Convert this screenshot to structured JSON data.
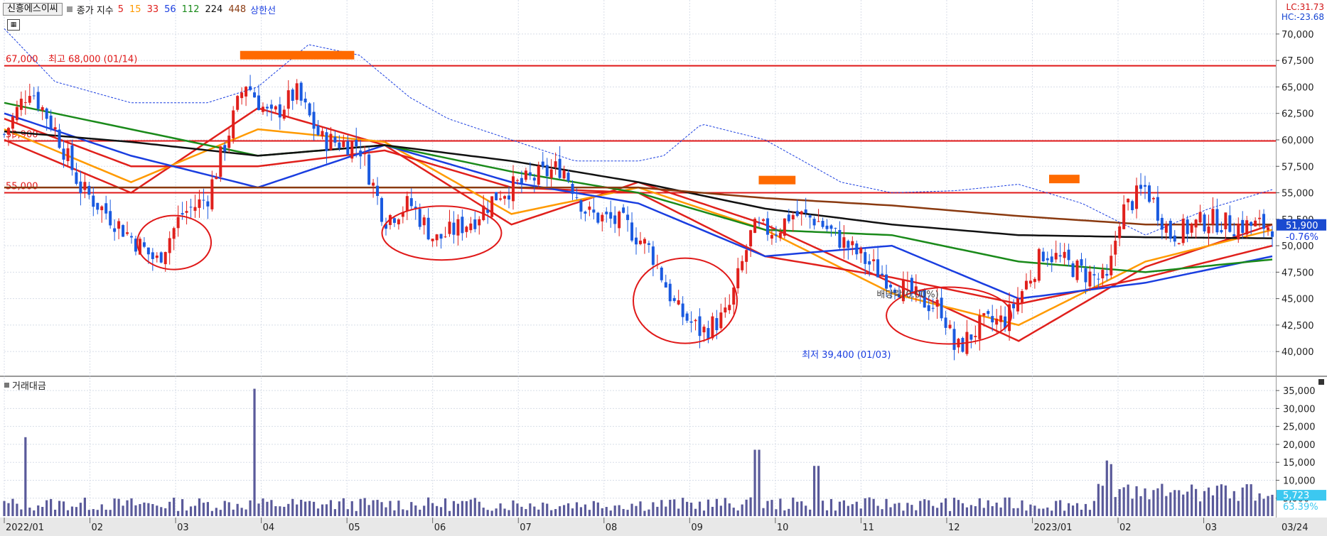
{
  "header": {
    "stock_name": "신흥에스이씨",
    "indicator_label": "종가 지수",
    "ma_labels": [
      {
        "text": "5",
        "color": "#e0201c"
      },
      {
        "text": "15",
        "color": "#ff9a00"
      },
      {
        "text": "33",
        "color": "#e0201c"
      },
      {
        "text": "56",
        "color": "#1a3ee0"
      },
      {
        "text": "112",
        "color": "#1a8a1a"
      },
      {
        "text": "224",
        "color": "#111111"
      },
      {
        "text": "448",
        "color": "#8a3a10"
      }
    ],
    "upper_band_label": "상한선",
    "lc_text": "LC:31.73",
    "hc_text": "HC:-23.68"
  },
  "volume_panel": {
    "title": "거래대금"
  },
  "chart_data": [
    {
      "type": "candlestick",
      "panel": "price",
      "period": "2022/01 – 2023/03/24 (daily)",
      "price_axis": {
        "ticks": [
          40000,
          42500,
          45000,
          47500,
          50000,
          52500,
          55000,
          57500,
          60000,
          62500,
          65000,
          67500,
          70000
        ],
        "tick_labels": [
          "40,000",
          "42,500",
          "45,000",
          "47,500",
          "50,000",
          "52,500",
          "55,000",
          "57,500",
          "60,000",
          "62,500",
          "65,000",
          "67,500",
          "70,000"
        ],
        "range": [
          38000,
          71200
        ]
      },
      "time_axis": {
        "labels": [
          "2022/01",
          "02",
          "03",
          "04",
          "05",
          "06",
          "07",
          "08",
          "09",
          "10",
          "11",
          "12",
          "2023/01",
          "02",
          "03"
        ],
        "end_label": "03/24"
      },
      "horizontal_lines": [
        {
          "value": 67000,
          "label": "67,000",
          "color": "#e01818"
        },
        {
          "value": 59900,
          "label": "59,900",
          "color": "#e01818"
        },
        {
          "value": 55000,
          "label": "55,000",
          "color": "#e01818"
        }
      ],
      "annotations": {
        "high": "최고 68,000 (01/14)",
        "low": "최저 39,400 (01/03)",
        "drop": "배당락(0.00%)"
      },
      "current_price": {
        "label": "51,900",
        "change": "-0.76%",
        "value": 51900
      },
      "close_path": {
        "x": [
          0,
          0.02,
          0.04,
          0.06,
          0.09,
          0.12,
          0.14,
          0.16,
          0.19,
          0.21,
          0.23,
          0.25,
          0.28,
          0.3,
          0.32,
          0.34,
          0.37,
          0.39,
          0.42,
          0.44,
          0.46,
          0.49,
          0.51,
          0.53,
          0.55,
          0.57,
          0.59,
          0.61,
          0.62,
          0.64,
          0.66,
          0.69,
          0.72,
          0.74,
          0.75,
          0.77,
          0.79,
          0.82,
          0.85,
          0.87,
          0.88,
          0.9,
          0.92,
          0.95,
          0.97,
          1.0
        ],
        "y": [
          60500,
          65000,
          61000,
          55500,
          52000,
          48500,
          53000,
          54500,
          65500,
          62000,
          64500,
          60000,
          59500,
          52500,
          54000,
          50500,
          52500,
          55000,
          56500,
          57500,
          53000,
          52000,
          49500,
          44000,
          41800,
          43500,
          51500,
          51500,
          53000,
          52500,
          50500,
          47500,
          45000,
          44000,
          40000,
          42500,
          43000,
          49500,
          47500,
          46500,
          53000,
          55500,
          51000,
          52500,
          51900,
          51900
        ]
      },
      "moving_averages": [
        {
          "name": "5",
          "color": "#e0201c",
          "x": [
            0,
            0.1,
            0.2,
            0.3,
            0.4,
            0.5,
            0.6,
            0.7,
            0.8,
            0.9,
            1.0
          ],
          "y": [
            60000,
            55000,
            63000,
            59500,
            52000,
            56000,
            52000,
            46500,
            41000,
            48000,
            52000
          ]
        },
        {
          "name": "15",
          "color": "#ff9a00",
          "x": [
            0,
            0.1,
            0.2,
            0.3,
            0.4,
            0.5,
            0.6,
            0.7,
            0.8,
            0.9,
            1.0
          ],
          "y": [
            61000,
            56000,
            61000,
            59800,
            53000,
            55500,
            51500,
            45500,
            42500,
            48500,
            51500
          ]
        },
        {
          "name": "33",
          "color": "#e0201c",
          "x": [
            0,
            0.1,
            0.2,
            0.3,
            0.4,
            0.5,
            0.6,
            0.7,
            0.8,
            0.9,
            1.0
          ],
          "y": [
            62000,
            57500,
            57500,
            59000,
            55500,
            55000,
            49000,
            47000,
            44500,
            47000,
            50000
          ]
        },
        {
          "name": "56",
          "color": "#1a3ee0",
          "x": [
            0,
            0.1,
            0.2,
            0.3,
            0.4,
            0.5,
            0.6,
            0.7,
            0.8,
            0.9,
            1.0
          ],
          "y": [
            62500,
            58500,
            55500,
            59500,
            56000,
            54000,
            49000,
            50000,
            45000,
            46500,
            49000
          ]
        },
        {
          "name": "112",
          "color": "#1a8a1a",
          "x": [
            0,
            0.1,
            0.2,
            0.3,
            0.4,
            0.5,
            0.6,
            0.7,
            0.8,
            0.9,
            1.0
          ],
          "y": [
            63500,
            61000,
            58500,
            59500,
            57000,
            55000,
            51500,
            51000,
            48500,
            47500,
            48700
          ]
        },
        {
          "name": "224",
          "color": "#111111",
          "x": [
            0,
            0.1,
            0.2,
            0.3,
            0.4,
            0.5,
            0.6,
            0.7,
            0.8,
            0.9,
            1.0
          ],
          "y": [
            60800,
            59800,
            58500,
            59500,
            58000,
            56000,
            53500,
            52000,
            51000,
            50800,
            50700
          ]
        },
        {
          "name": "448",
          "color": "#8a3a10",
          "x": [
            0,
            0.1,
            0.2,
            0.3,
            0.4,
            0.5,
            0.6,
            0.7,
            0.8,
            0.9,
            1.0
          ],
          "y": [
            55500,
            55500,
            55500,
            55500,
            55500,
            55500,
            54500,
            53800,
            52800,
            52000,
            52000
          ]
        }
      ],
      "upper_band": {
        "name": "상한선",
        "color": "#1a3ee0",
        "x": [
          0,
          0.04,
          0.1,
          0.16,
          0.2,
          0.24,
          0.28,
          0.32,
          0.35,
          0.4,
          0.45,
          0.5,
          0.52,
          0.55,
          0.6,
          0.66,
          0.7,
          0.75,
          0.8,
          0.85,
          0.9,
          0.95,
          1.0
        ],
        "y": [
          70500,
          65500,
          63500,
          63500,
          65000,
          69000,
          68000,
          64000,
          62000,
          60000,
          58000,
          58000,
          58500,
          61500,
          60000,
          56000,
          55000,
          55200,
          55800,
          54000,
          51000,
          53500,
          55300
        ]
      }
    },
    {
      "type": "bar",
      "panel": "volume",
      "title": "거래대금",
      "y_axis": {
        "ticks": [
          5000,
          10000,
          15000,
          20000,
          25000,
          30000,
          35000
        ],
        "tick_labels": [
          "5,000",
          "10,000",
          "15,000",
          "20,000",
          "25,000",
          "30,000",
          "35,000"
        ],
        "range": [
          0,
          37000
        ]
      },
      "current": {
        "label": "5,723",
        "ratio": "63.39%",
        "value": 5723
      },
      "spikes": [
        {
          "x": 0.016,
          "value": 22000
        },
        {
          "x": 0.198,
          "value": 35500
        },
        {
          "x": 0.593,
          "value": 18500
        },
        {
          "x": 0.64,
          "value": 14000
        },
        {
          "x": 0.87,
          "value": 15500
        },
        {
          "x": 0.873,
          "value": 14500
        },
        {
          "x": 0.913,
          "value": 9000
        }
      ],
      "baseline_volume": 3500
    }
  ]
}
